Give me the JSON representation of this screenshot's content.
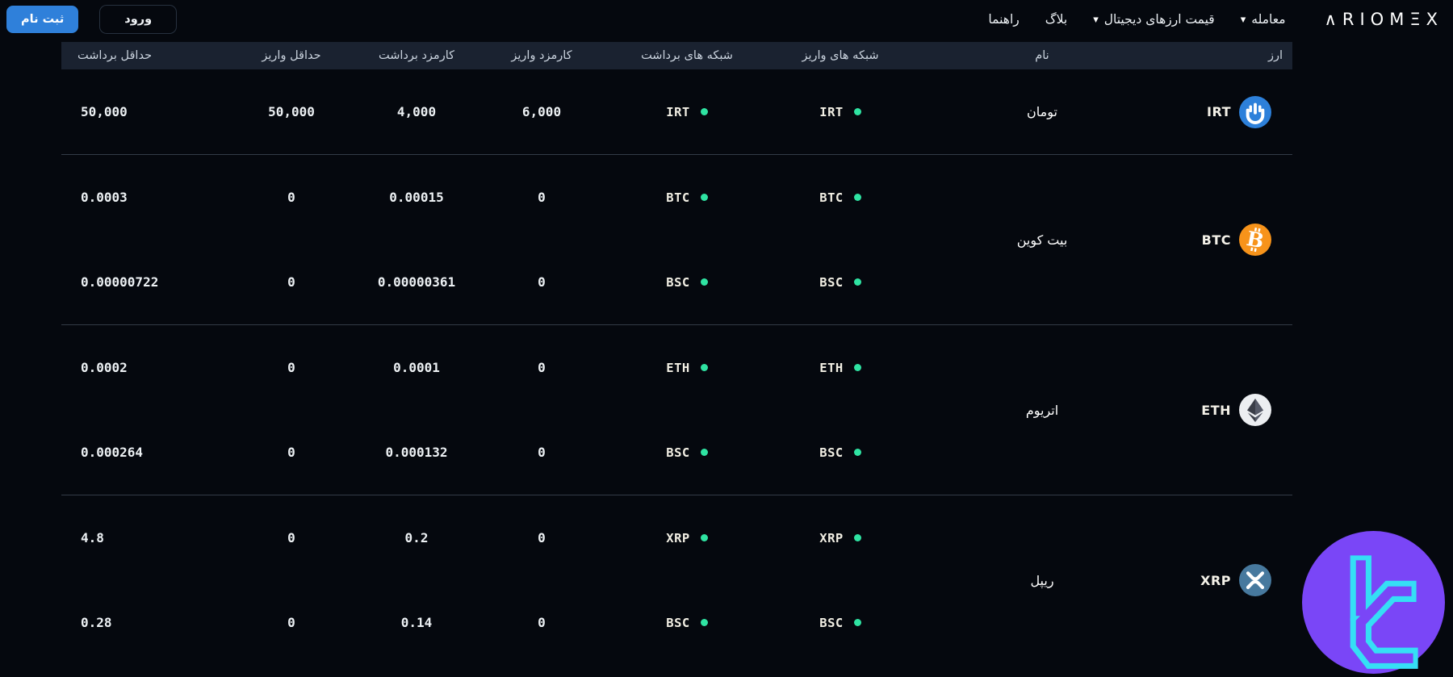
{
  "navbar": {
    "brand": "∧RIOMΞX",
    "signup_label": "ثبت نام",
    "login_label": "ورود",
    "links": [
      {
        "label": "راهنما",
        "caret": false
      },
      {
        "label": "بلاگ",
        "caret": false
      },
      {
        "label": "قیمت ارزهای دیجیتال",
        "caret": true
      },
      {
        "label": "معامله",
        "caret": true
      }
    ]
  },
  "table": {
    "headers": [
      "ارز",
      "نام",
      "شبکه های واریز",
      "شبکه های برداشت",
      "کارمزد واریز",
      "کارمزد برداشت",
      "حداقل واریز",
      "حداقل برداشت"
    ],
    "status_dot_color": "#2fe3a2",
    "rows": [
      {
        "code": "IRT",
        "name": "تومان",
        "icon": "toman-icon",
        "icon_bg": "#2d80da",
        "networks": [
          {
            "deposit_network": "IRT",
            "withdraw_network": "IRT",
            "deposit_fee": "6,000",
            "withdraw_fee": "4,000",
            "min_deposit": "50,000",
            "min_withdraw": "50,000"
          }
        ]
      },
      {
        "code": "BTC",
        "name": "بیت کوین",
        "icon": "bitcoin-icon",
        "icon_bg": "#f7931a",
        "networks": [
          {
            "deposit_network": "BTC",
            "withdraw_network": "BTC",
            "deposit_fee": "0",
            "withdraw_fee": "0.00015",
            "min_deposit": "0",
            "min_withdraw": "0.0003"
          },
          {
            "deposit_network": "BSC",
            "withdraw_network": "BSC",
            "deposit_fee": "0",
            "withdraw_fee": "0.00000361",
            "min_deposit": "0",
            "min_withdraw": "0.00000722"
          }
        ]
      },
      {
        "code": "ETH",
        "name": "اتریوم",
        "icon": "ethereum-icon",
        "icon_bg": "#eceef1",
        "networks": [
          {
            "deposit_network": "ETH",
            "withdraw_network": "ETH",
            "deposit_fee": "0",
            "withdraw_fee": "0.0001",
            "min_deposit": "0",
            "min_withdraw": "0.0002"
          },
          {
            "deposit_network": "BSC",
            "withdraw_network": "BSC",
            "deposit_fee": "0",
            "withdraw_fee": "0.000132",
            "min_deposit": "0",
            "min_withdraw": "0.000264"
          }
        ]
      },
      {
        "code": "XRP",
        "name": "ریپل",
        "icon": "xrp-icon",
        "icon_bg": "#47799e",
        "networks": [
          {
            "deposit_network": "XRP",
            "withdraw_network": "XRP",
            "deposit_fee": "0",
            "withdraw_fee": "0.2",
            "min_deposit": "0",
            "min_withdraw": "4.8"
          },
          {
            "deposit_network": "BSC",
            "withdraw_network": "BSC",
            "deposit_fee": "0",
            "withdraw_fee": "0.14",
            "min_deposit": "0",
            "min_withdraw": "0.28"
          }
        ]
      }
    ]
  },
  "watermark": {
    "icon": "support-logo-icon",
    "circle_color": "#7a46f7",
    "glyph_color": "#35dff5"
  }
}
